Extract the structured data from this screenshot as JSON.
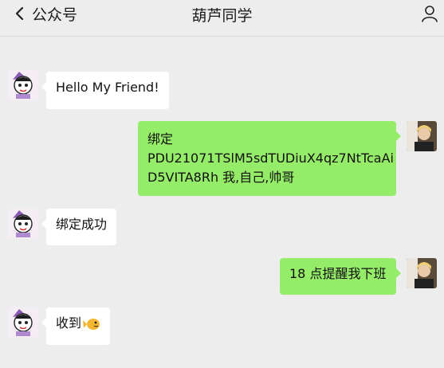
{
  "header": {
    "back_label": "公众号",
    "title": "葫芦同学",
    "right_icon": "person-icon"
  },
  "messages": [
    {
      "side": "left",
      "text": "Hello My Friend!"
    },
    {
      "side": "right",
      "lines": [
        "绑定",
        "PDU21071TSlM5sdTUDiuX4qz7NtTcaAi",
        "D5VITA8Rh 我,自己,帅哥"
      ]
    },
    {
      "side": "left",
      "text": "绑定成功"
    },
    {
      "side": "right",
      "text": "18 点提醒我下班"
    },
    {
      "side": "left",
      "text": "收到",
      "emoji": "fish-emoji"
    }
  ],
  "colors": {
    "background": "#ededed",
    "incoming_bubble": "#ffffff",
    "outgoing_bubble": "#95ec69"
  }
}
